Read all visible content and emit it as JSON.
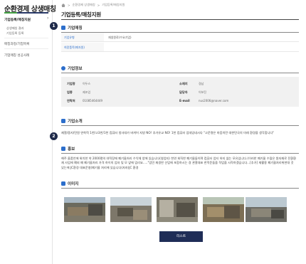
{
  "sidebar": {
    "title": "순환경제 상생매칭",
    "active_menu": "기업등록/매칭지원",
    "sub_items": [
      "상생매칭 결과",
      "기업등록 등록"
    ],
    "menus": [
      "매칭과정/기업목록",
      "기업매칭 성공사례"
    ]
  },
  "breadcrumb": [
    "순환경제 상생매칭",
    "기업등록/매칭지원"
  ],
  "page_title": "기업등록/매칭지원",
  "badges": [
    "1",
    "2"
  ],
  "matching": {
    "heading": "기업매칭",
    "rows": [
      {
        "label": "기업유형",
        "value": "재생원료(수요기업)"
      },
      {
        "label": "희망품목(폐자원)",
        "value": ""
      }
    ]
  },
  "company_info": {
    "heading": "기업정보",
    "fields": [
      {
        "label": "기업명",
        "value": "이두스"
      },
      {
        "label": "소재지",
        "value": "경남"
      },
      {
        "label": "업종",
        "value": "제조업"
      },
      {
        "label": "담당자",
        "value": "이보진"
      },
      {
        "label": "연락처",
        "value": "01085464449"
      },
      {
        "label": "E-mail",
        "value": "nus2006@naver.com"
      }
    ]
  },
  "intro": {
    "heading": "기업소개",
    "text": "제철/중지/민원 연착적 1천/고3천/1천 컴퓨터 청사대가 바끼어 지방 NO! 추가유교 NO! 1천 컴퓨터 업데있네시다 \"고운명은 마음의란 대한민국의 미래 환경을 생각합니다\""
  },
  "promo": {
    "heading": "홍보",
    "text": "해주 울품언에 위치한 약 2000평의 야적장에 폐기물처리 수익체 양에 있습니다(영업지) 천연 회직한 폐기물들이며 컴퓨터 업티 하지 않는 모유입니다.(이러한 폐기물 수많은 원자재로 전환환 재 사업에 예외 폐 폐기물처리 가격 하이의 업자 및 모 앞에 업리요.....\"업민 재생한 산업에 포함하시는 경 관찰대표 한적운들을 작업을 시작하겠습니다...[추가] 재활용 폐기물처리위한대 것 있는에 JC환경 대표운영(폐기물 처리에 있습니다(자자)JC 환경"
  },
  "images": {
    "heading": "이미지",
    "count": 6
  },
  "list_button": "리스트",
  "colors": {
    "navy": "#1f2d57",
    "accent_green": "#45a245",
    "link_blue": "#2c6ecb"
  }
}
